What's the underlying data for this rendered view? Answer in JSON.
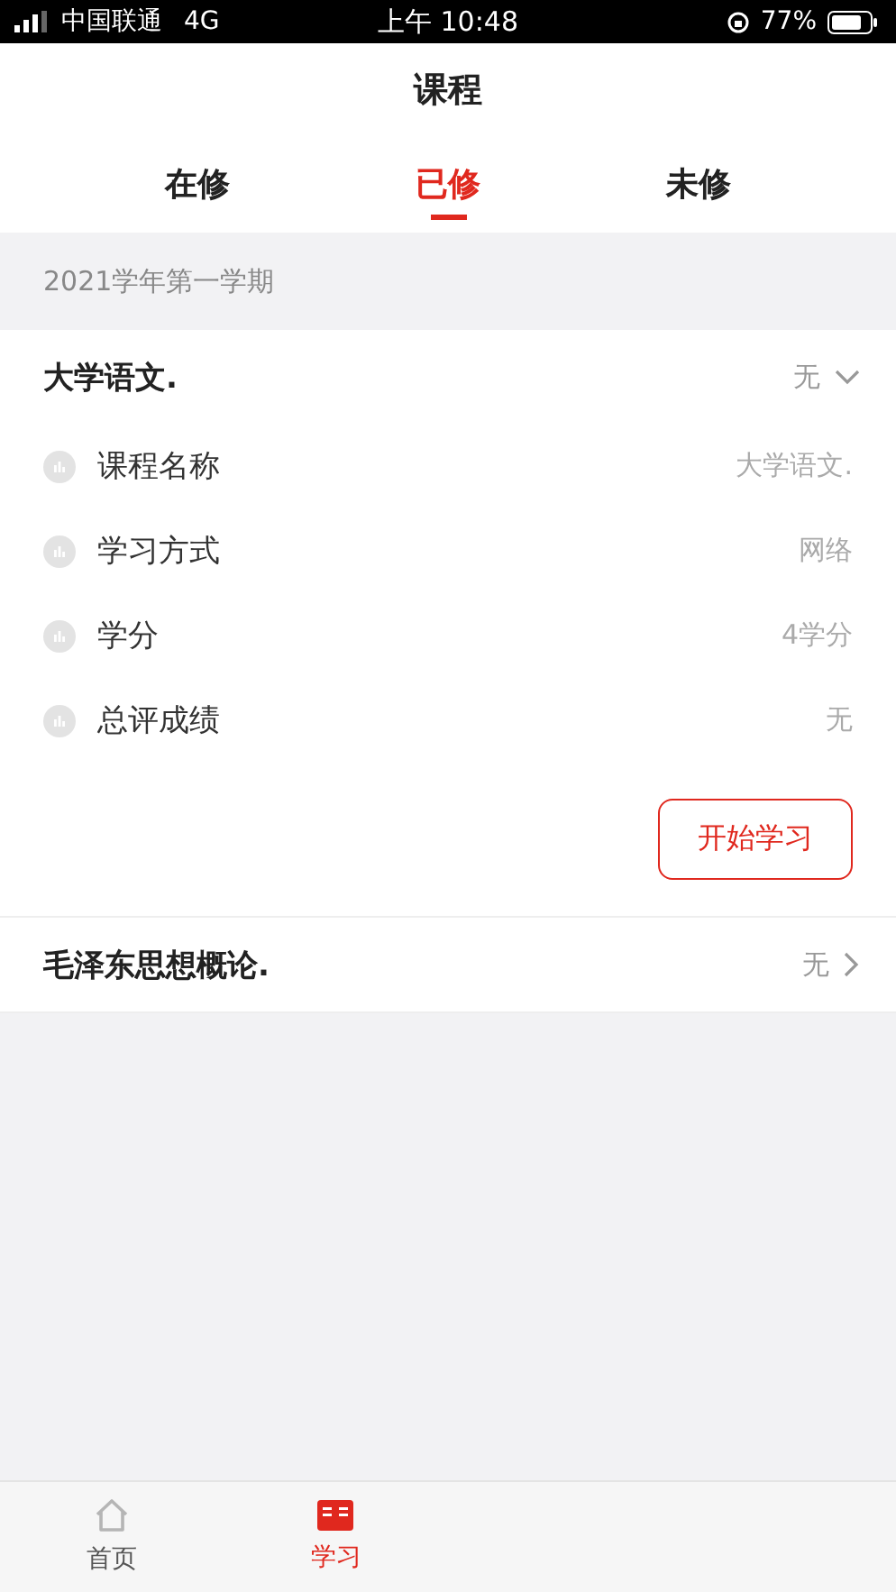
{
  "status_bar": {
    "carrier": "中国联通",
    "network": "4G",
    "time": "上午 10:48",
    "battery": "77%"
  },
  "title": "课程",
  "tabs": [
    {
      "label": "在修",
      "selected": false
    },
    {
      "label": "已修",
      "selected": true
    },
    {
      "label": "未修",
      "selected": false
    }
  ],
  "semester": "2021学年第一学期",
  "courses": [
    {
      "name": "大学语文.",
      "grade": "无",
      "expanded": true,
      "details": [
        {
          "label": "课程名称",
          "value": "大学语文."
        },
        {
          "label": "学习方式",
          "value": "网络"
        },
        {
          "label": "学分",
          "value": "4学分"
        },
        {
          "label": "总评成绩",
          "value": "无"
        }
      ],
      "action": "开始学习"
    },
    {
      "name": "毛泽东思想概论.",
      "grade": "无",
      "expanded": false
    }
  ],
  "bottom_nav": [
    {
      "label": "首页",
      "kind": "home",
      "selected": false
    },
    {
      "label": "学习",
      "kind": "study",
      "selected": true
    }
  ]
}
